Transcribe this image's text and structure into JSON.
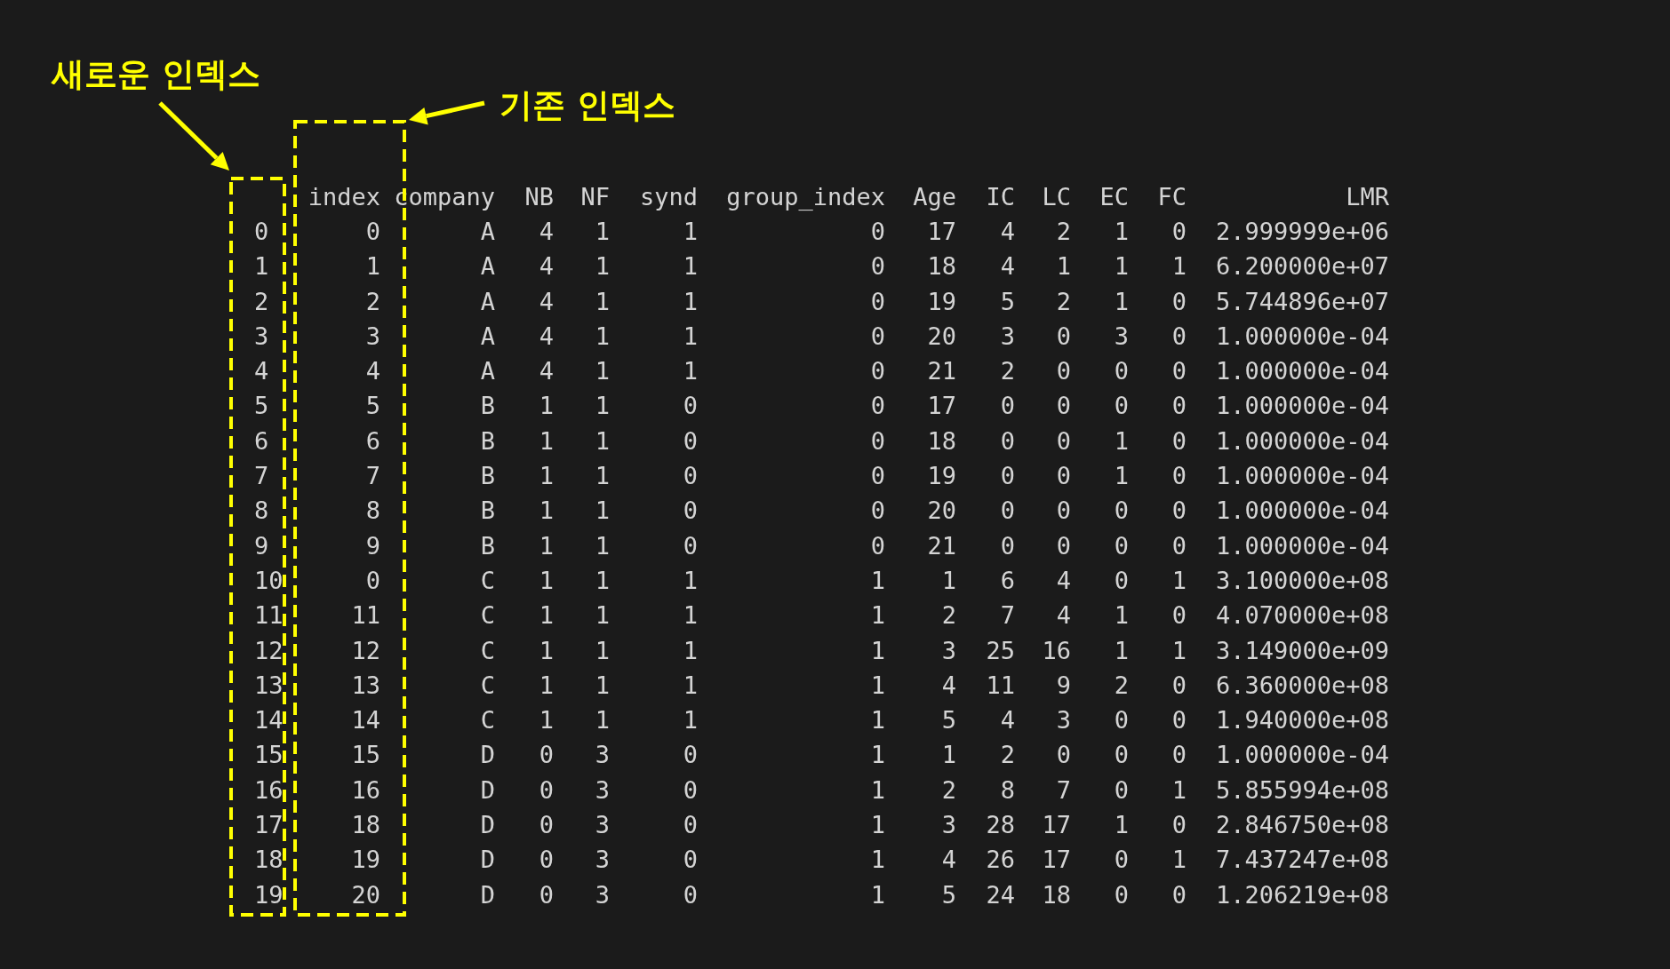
{
  "annotations": [
    {
      "text": "새로운 인덱스"
    },
    {
      "text": "기존 인덱스"
    }
  ],
  "table": {
    "columns": [
      "index",
      "company",
      "NB",
      "NF",
      "synd",
      "group_index",
      "Age",
      "IC",
      "LC",
      "EC",
      "FC",
      "LMR"
    ],
    "rows": [
      {
        "label": "0",
        "cells": [
          "0",
          "A",
          "4",
          "1",
          "1",
          "0",
          "17",
          "4",
          "2",
          "1",
          "0",
          "2.999999e+06"
        ]
      },
      {
        "label": "1",
        "cells": [
          "1",
          "A",
          "4",
          "1",
          "1",
          "0",
          "18",
          "4",
          "1",
          "1",
          "1",
          "6.200000e+07"
        ]
      },
      {
        "label": "2",
        "cells": [
          "2",
          "A",
          "4",
          "1",
          "1",
          "0",
          "19",
          "5",
          "2",
          "1",
          "0",
          "5.744896e+07"
        ]
      },
      {
        "label": "3",
        "cells": [
          "3",
          "A",
          "4",
          "1",
          "1",
          "0",
          "20",
          "3",
          "0",
          "3",
          "0",
          "1.000000e-04"
        ]
      },
      {
        "label": "4",
        "cells": [
          "4",
          "A",
          "4",
          "1",
          "1",
          "0",
          "21",
          "2",
          "0",
          "0",
          "0",
          "1.000000e-04"
        ]
      },
      {
        "label": "5",
        "cells": [
          "5",
          "B",
          "1",
          "1",
          "0",
          "0",
          "17",
          "0",
          "0",
          "0",
          "0",
          "1.000000e-04"
        ]
      },
      {
        "label": "6",
        "cells": [
          "6",
          "B",
          "1",
          "1",
          "0",
          "0",
          "18",
          "0",
          "0",
          "1",
          "0",
          "1.000000e-04"
        ]
      },
      {
        "label": "7",
        "cells": [
          "7",
          "B",
          "1",
          "1",
          "0",
          "0",
          "19",
          "0",
          "0",
          "1",
          "0",
          "1.000000e-04"
        ]
      },
      {
        "label": "8",
        "cells": [
          "8",
          "B",
          "1",
          "1",
          "0",
          "0",
          "20",
          "0",
          "0",
          "0",
          "0",
          "1.000000e-04"
        ]
      },
      {
        "label": "9",
        "cells": [
          "9",
          "B",
          "1",
          "1",
          "0",
          "0",
          "21",
          "0",
          "0",
          "0",
          "0",
          "1.000000e-04"
        ]
      },
      {
        "label": "10",
        "cells": [
          "0",
          "C",
          "1",
          "1",
          "1",
          "1",
          "1",
          "6",
          "4",
          "0",
          "1",
          "3.100000e+08"
        ]
      },
      {
        "label": "11",
        "cells": [
          "11",
          "C",
          "1",
          "1",
          "1",
          "1",
          "2",
          "7",
          "4",
          "1",
          "0",
          "4.070000e+08"
        ]
      },
      {
        "label": "12",
        "cells": [
          "12",
          "C",
          "1",
          "1",
          "1",
          "1",
          "3",
          "25",
          "16",
          "1",
          "1",
          "3.149000e+09"
        ]
      },
      {
        "label": "13",
        "cells": [
          "13",
          "C",
          "1",
          "1",
          "1",
          "1",
          "4",
          "11",
          "9",
          "2",
          "0",
          "6.360000e+08"
        ]
      },
      {
        "label": "14",
        "cells": [
          "14",
          "C",
          "1",
          "1",
          "1",
          "1",
          "5",
          "4",
          "3",
          "0",
          "0",
          "1.940000e+08"
        ]
      },
      {
        "label": "15",
        "cells": [
          "15",
          "D",
          "0",
          "3",
          "0",
          "1",
          "1",
          "2",
          "0",
          "0",
          "0",
          "1.000000e-04"
        ]
      },
      {
        "label": "16",
        "cells": [
          "16",
          "D",
          "0",
          "3",
          "0",
          "1",
          "2",
          "8",
          "7",
          "0",
          "1",
          "5.855994e+08"
        ]
      },
      {
        "label": "17",
        "cells": [
          "18",
          "D",
          "0",
          "3",
          "0",
          "1",
          "3",
          "28",
          "17",
          "1",
          "0",
          "2.846750e+08"
        ]
      },
      {
        "label": "18",
        "cells": [
          "19",
          "D",
          "0",
          "3",
          "0",
          "1",
          "4",
          "26",
          "17",
          "0",
          "1",
          "7.437247e+08"
        ]
      },
      {
        "label": "19",
        "cells": [
          "20",
          "D",
          "0",
          "3",
          "0",
          "1",
          "5",
          "24",
          "18",
          "0",
          "0",
          "1.206219e+08"
        ]
      }
    ]
  }
}
